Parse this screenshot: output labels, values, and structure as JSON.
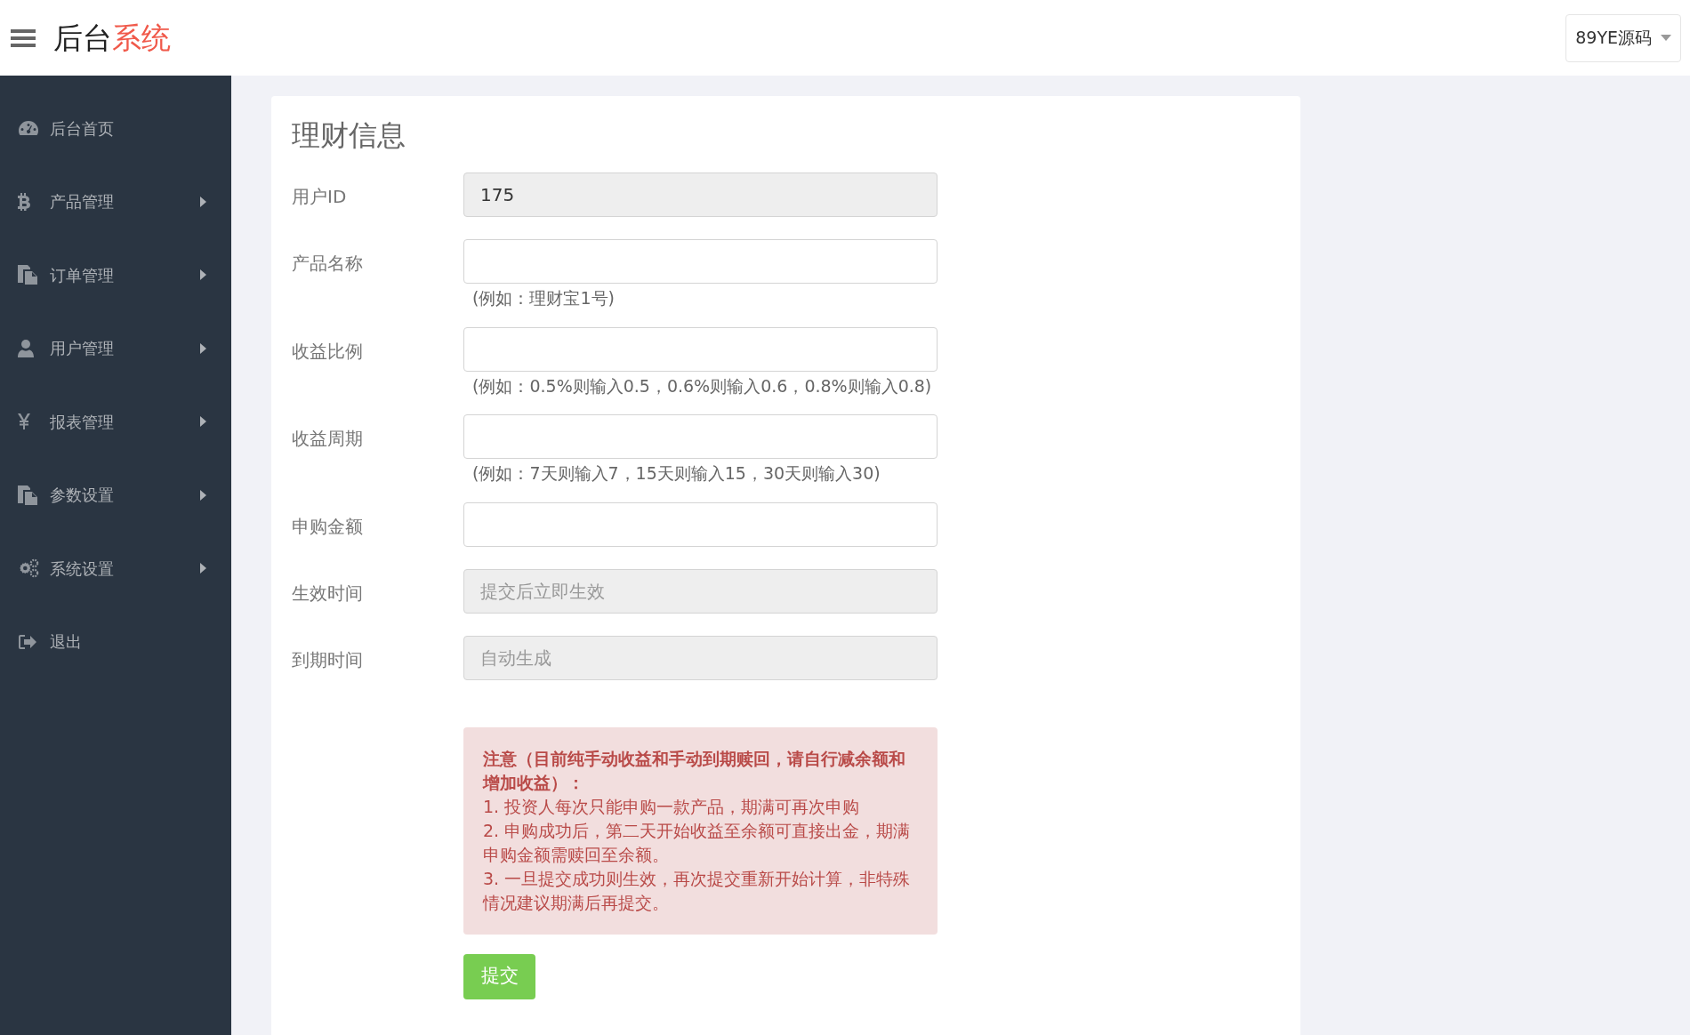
{
  "header": {
    "brand_dark": "后台",
    "brand_accent": "系统",
    "user_menu": "89YE源码"
  },
  "sidebar": {
    "items": [
      {
        "label": "后台首页",
        "kind": "dashboard",
        "has_submenu": false
      },
      {
        "label": "产品管理",
        "kind": "bitcoin",
        "has_submenu": true
      },
      {
        "label": "订单管理",
        "kind": "files",
        "has_submenu": true
      },
      {
        "label": "用户管理",
        "kind": "user",
        "has_submenu": true
      },
      {
        "label": "报表管理",
        "kind": "yen",
        "has_submenu": true
      },
      {
        "label": "参数设置",
        "kind": "files",
        "has_submenu": true
      },
      {
        "label": "系统设置",
        "kind": "gears",
        "has_submenu": true
      },
      {
        "label": "退出",
        "kind": "signout",
        "has_submenu": false
      }
    ]
  },
  "form": {
    "title": "理财信息",
    "fields": [
      {
        "label": "用户ID",
        "value": "175",
        "disabled": true
      },
      {
        "label": "产品名称",
        "disabled": false,
        "hint": "(例如：理财宝1号)"
      },
      {
        "label": "收益比例",
        "disabled": false,
        "hint": "(例如：0.5%则输入0.5，0.6%则输入0.6，0.8%则输入0.8)"
      },
      {
        "label": "收益周期",
        "disabled": false,
        "hint": "(例如：7天则输入7，15天则输入15，30天则输入30)"
      },
      {
        "label": "申购金额",
        "disabled": false
      },
      {
        "label": "生效时间",
        "placeholder": "提交后立即生效",
        "disabled": true
      },
      {
        "label": "到期时间",
        "placeholder": "自动生成",
        "disabled": true
      }
    ],
    "notice": {
      "title": "注意（目前纯手动收益和手动到期赎回，请自行减余额和增加收益）：",
      "lines": [
        "1. 投资人每次只能申购一款产品，期满可再次申购",
        "2. 申购成功后，第二天开始收益至余额可直接出金，期满申购金额需赎回至余额。",
        "3. 一旦提交成功则生效，再次提交重新开始计算，非特殊情况建议期满后再提交。"
      ]
    },
    "submit": "提交"
  }
}
